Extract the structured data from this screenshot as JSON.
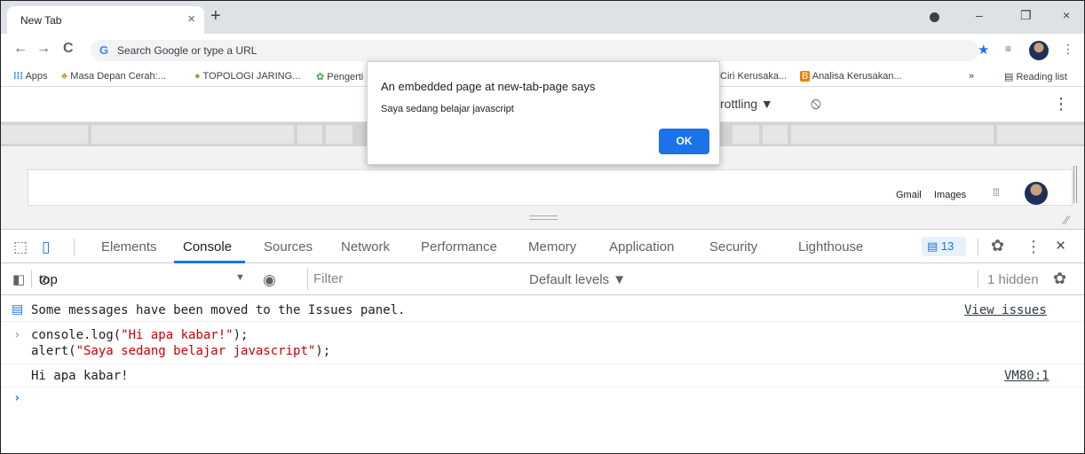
{
  "browser": {
    "tab_title": "New Tab",
    "tab_close": "×",
    "new_tab": "+",
    "window_controls": [
      "–",
      "❐",
      "×"
    ],
    "omnibox_placeholder": "Search Google or type a URL",
    "bookmarks": [
      "Apps",
      "Masa Depan Cerah:...",
      "TOPOLOGI JARING...",
      "Pengerti",
      "Ciri Kerusaka...",
      "Analisa Kerusakan..."
    ],
    "bookmarks_overflow": "»",
    "reading_list": "Reading list"
  },
  "device_toolbar": {
    "throttling": "rottling ▼"
  },
  "viewport": {
    "links": [
      "Gmail",
      "Images"
    ]
  },
  "devtools": {
    "tabs": [
      "Elements",
      "Console",
      "Sources",
      "Network",
      "Performance",
      "Memory",
      "Application",
      "Security",
      "Lighthouse"
    ],
    "active_tab": "Console",
    "issues_count": "13",
    "context": "top",
    "filter_placeholder": "Filter",
    "levels": "Default levels ▼",
    "hidden": "1 hidden"
  },
  "console": {
    "issues_message": "Some messages have been moved to the Issues panel.",
    "view_issues": "View issues",
    "input_line1_prefix": "console.log(",
    "input_line1_string": "\"Hi apa kabar!\"",
    "input_line1_suffix": ");",
    "input_line2_prefix": "alert(",
    "input_line2_string": "\"Saya sedang belajar javascript\"",
    "input_line2_suffix": ");",
    "output": "Hi apa kabar!",
    "source_link": "VM80:1"
  },
  "dialog": {
    "title": "An embedded page at new-tab-page says",
    "message": "Saya sedang belajar javascript",
    "ok_label": "OK"
  },
  "colors": {
    "accent": "#1a73e8",
    "string": "#c80000",
    "titlebar": "#dee1e6"
  }
}
